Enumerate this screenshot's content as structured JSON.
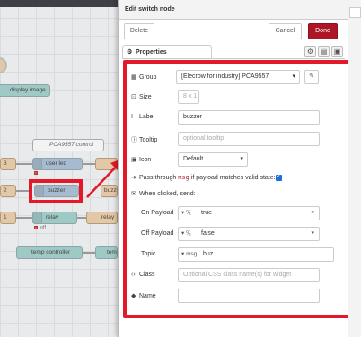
{
  "canvas": {
    "comment_label": "PCA9557 control",
    "nodes": {
      "user_led": "user led",
      "buzzer": "buzzer",
      "relay": "relay",
      "temp_controller": "temp controller",
      "display_image": "display image",
      "buzz_partial": "buzz",
      "relay_partial": "relay",
      "temp_partial": "tem"
    },
    "left_numbers": [
      "3",
      "2",
      "1"
    ],
    "status_off": "off"
  },
  "tray": {
    "title": "Edit switch node",
    "delete_label": "Delete",
    "cancel_label": "Cancel",
    "done_label": "Done",
    "tab_label": "Properties",
    "form": {
      "group_label": "Group",
      "group_value": "[Elecrow for industry] PCA9557",
      "size_label": "Size",
      "size_value": "8 x 1",
      "label_label": "Label",
      "label_value": "buzzer",
      "tooltip_label": "Tooltip",
      "tooltip_placeholder": "optional tooltip",
      "icon_label": "Icon",
      "icon_value": "Default",
      "passthrough_pre": "Pass through",
      "passthrough_msg": "msg",
      "passthrough_post": "if payload matches valid state:",
      "when_clicked_label": "When clicked, send:",
      "on_payload_label": "On Payload",
      "on_payload_type": "⁰⁄₁",
      "on_payload_value": "true",
      "off_payload_label": "Off Payload",
      "off_payload_type": "⁰⁄₁",
      "off_payload_value": "false",
      "topic_label": "Topic",
      "topic_type": "msg.",
      "topic_value": "buz",
      "class_label": "Class",
      "class_placeholder": "Optional CSS class name(s) for widget",
      "name_label": "Name",
      "name_value": ""
    }
  },
  "colors": {
    "highlight": "#e3192a",
    "done_button": "#ad1625",
    "checkbox": "#1e6dd8"
  }
}
